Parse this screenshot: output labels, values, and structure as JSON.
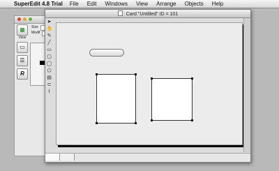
{
  "menubar": {
    "app_name": "SuperEdit 4.8 Trial",
    "items": [
      "File",
      "Edit",
      "Windows",
      "View",
      "Arrange",
      "Objects",
      "Help"
    ]
  },
  "back_window": {
    "tool_labels": [
      "View",
      "R"
    ],
    "prop_rows": [
      "Size",
      "Modif"
    ]
  },
  "card_window": {
    "title": "Card \"Untitled\" ID = 101"
  },
  "colors": {
    "desktop": "#b9b9b9",
    "canvas": "#ececec",
    "shadow": "#000000"
  }
}
